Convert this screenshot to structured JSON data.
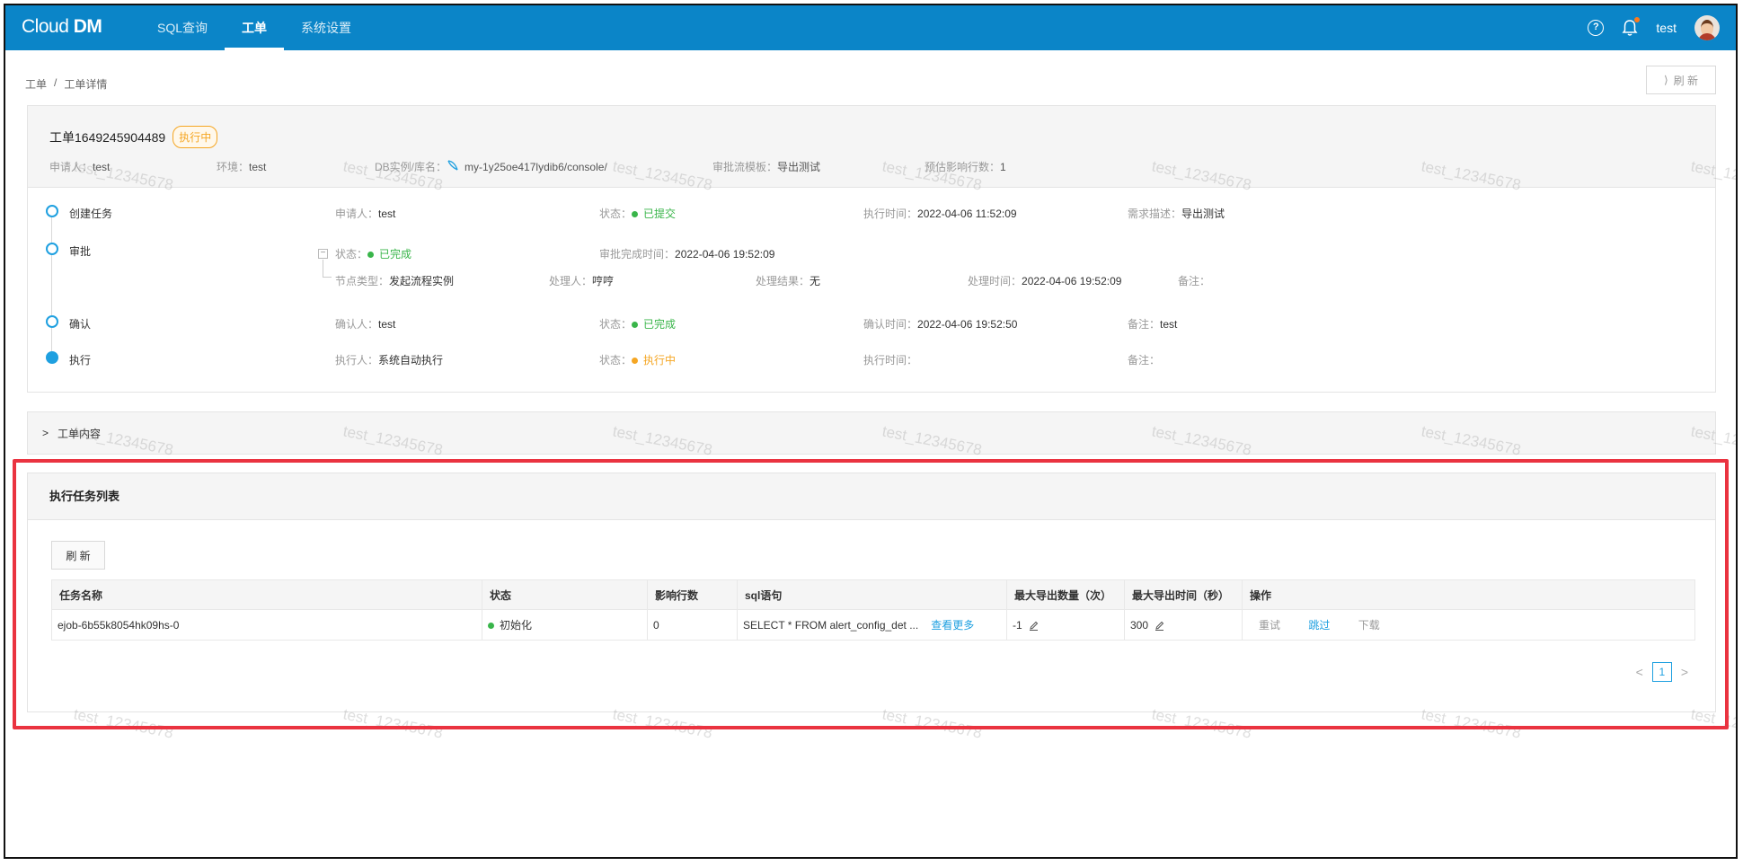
{
  "app": {
    "logo_text": "Cloud DM",
    "logo_prefix": "Cloud ",
    "logo_suffix": "DM"
  },
  "nav": {
    "items": [
      {
        "label": "SQL查询"
      },
      {
        "label": "工单"
      },
      {
        "label": "系统设置"
      }
    ],
    "active_index": 1
  },
  "topbar": {
    "help": "?",
    "user": "test"
  },
  "breadcrumb": {
    "root": "工单",
    "sep": "/",
    "current": "工单详情"
  },
  "refresh_top": {
    "label": "刷 新"
  },
  "order": {
    "title": "工单1649245904489",
    "status": "执行中",
    "meta": {
      "applicant_k": "申请人：",
      "applicant_v": "test",
      "env_k": "环境：",
      "env_v": "test",
      "db_k": "DB实例/库名：",
      "db_v": "my-1y25oe417lydib6/console/",
      "template_k": "审批流模板：",
      "template_v": "导出测试",
      "rows_k": "预估影响行数：",
      "rows_v": "1"
    }
  },
  "timeline": {
    "create": {
      "label": "创建任务",
      "applicant_k": "申请人：",
      "applicant_v": "test",
      "status_k": "状态：",
      "status_v": "已提交",
      "time_k": "执行时间：",
      "time_v": "2022-04-06 11:52:09",
      "desc_k": "需求描述：",
      "desc_v": "导出测试"
    },
    "approve": {
      "label": "审批",
      "collapse": "−",
      "status_k": "状态：",
      "status_v": "已完成",
      "done_k": "审批完成时间：",
      "done_v": "2022-04-06 19:52:09",
      "node_k": "节点类型：",
      "node_v": "发起流程实例",
      "handler_k": "处理人：",
      "handler_v": "哼哼",
      "result_k": "处理结果：",
      "result_v": "无",
      "htime_k": "处理时间：",
      "htime_v": "2022-04-06 19:52:09",
      "note_k": "备注：",
      "note_v": ""
    },
    "confirm": {
      "label": "确认",
      "person_k": "确认人：",
      "person_v": "test",
      "status_k": "状态：",
      "status_v": "已完成",
      "time_k": "确认时间：",
      "time_v": "2022-04-06 19:52:50",
      "note_k": "备注：",
      "note_v": "test"
    },
    "execute": {
      "label": "执行",
      "person_k": "执行人：",
      "person_v": "系统自动执行",
      "status_k": "状态：",
      "status_v": "执行中",
      "time_k": "执行时间：",
      "time_v": "",
      "note_k": "备注：",
      "note_v": ""
    }
  },
  "content_section": {
    "chevron": ">",
    "label": "工单内容"
  },
  "task_list": {
    "title": "执行任务列表",
    "refresh_label": "刷 新",
    "columns": [
      "任务名称",
      "状态",
      "影响行数",
      "sql语句",
      "最大导出数量（次）",
      "最大导出时间（秒）",
      "操作"
    ],
    "rows": [
      {
        "name": "ejob-6b55k8054hk09hs-0",
        "status": "初始化",
        "rows": "0",
        "sql": "SELECT * FROM alert_config_det ...",
        "sql_more": "查看更多",
        "max_count": "-1",
        "max_time": "300",
        "op_retry": "重试",
        "op_skip": "跳过",
        "op_download": "下载"
      }
    ],
    "pager": {
      "prev": "<",
      "page": "1",
      "next": ">"
    }
  },
  "watermark": "test_12345678",
  "colors": {
    "topbar": "#0b85c8",
    "accent": "#1fa0e0",
    "success": "#39b54a",
    "warning": "#f5a623",
    "highlight": "#ea3340"
  }
}
